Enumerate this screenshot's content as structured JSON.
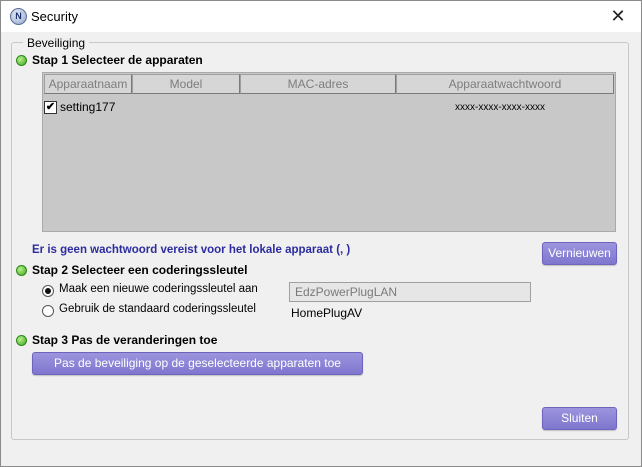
{
  "window": {
    "title": "Security",
    "close_glyph": "✕",
    "app_icon_letter": "N"
  },
  "group": {
    "legend": "Beveiliging"
  },
  "step1": {
    "label": "Stap 1 Selecteer de apparaten",
    "columns": [
      "Apparaatnaam",
      "Model",
      "MAC-adres",
      "Apparaatwachtwoord"
    ],
    "rows": [
      {
        "checked": true,
        "check_glyph": "✔",
        "name": "setting177",
        "model": "",
        "mac": "",
        "password": "xxxx-xxxx-xxxx-xxxx"
      }
    ],
    "info": "Er is geen wachtwoord vereist voor het lokale apparaat (, )",
    "refresh_button": "Vernieuwen"
  },
  "step2": {
    "label": "Stap 2 Selecteer een coderingssleutel",
    "option_new": "Maak een nieuwe coderingssleutel aan",
    "option_default": "Gebruik de standaard coderingssleutel",
    "new_key_value": "EdzPowerPlugLAN",
    "default_key": "HomePlugAV",
    "selected": "new"
  },
  "step3": {
    "label": "Stap 3 Pas de veranderingen toe",
    "apply_button": "Pas de beveiliging op de geselecteerde apparaten toe"
  },
  "close_button": "Sluiten",
  "colors": {
    "accent": "#8880d6",
    "status_green": "#3fa51f",
    "info_text": "#2c2ca0"
  }
}
